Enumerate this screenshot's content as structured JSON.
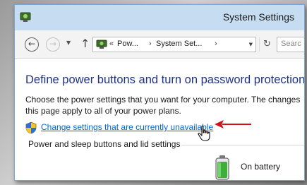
{
  "window": {
    "title": "System Settings",
    "titlebar_color": "#c6ddf1",
    "app_icon": "system-settings-icon"
  },
  "navigation": {
    "back_icon": "arrow-left-icon",
    "forward_icon": "arrow-right-icon",
    "recent_icon": "chevron-down-icon",
    "up_icon": "arrow-up-icon",
    "refresh_icon": "refresh-icon",
    "back_glyph": "←",
    "forward_glyph": "→",
    "dropdown_glyph": "▼",
    "up_glyph": "↑",
    "refresh_glyph": "↻"
  },
  "address_bar": {
    "overflow_marker": "«",
    "separator": "›",
    "segments": [
      "Pow...",
      "System Set..."
    ]
  },
  "search": {
    "placeholder": "Searc"
  },
  "main": {
    "heading": "Define power buttons and turn on password protection",
    "heading_color": "#1e3287",
    "description_lines": [
      "Choose the power settings that you want for your computer. The changes",
      "this page apply to all of your power plans."
    ],
    "change_link": "Change settings that are currently unavailable",
    "link_color": "#0066cc",
    "annotation_arrow_color": "#d0121b",
    "section_title": "Power and sleep buttons and lid settings",
    "battery_label": "On battery"
  }
}
